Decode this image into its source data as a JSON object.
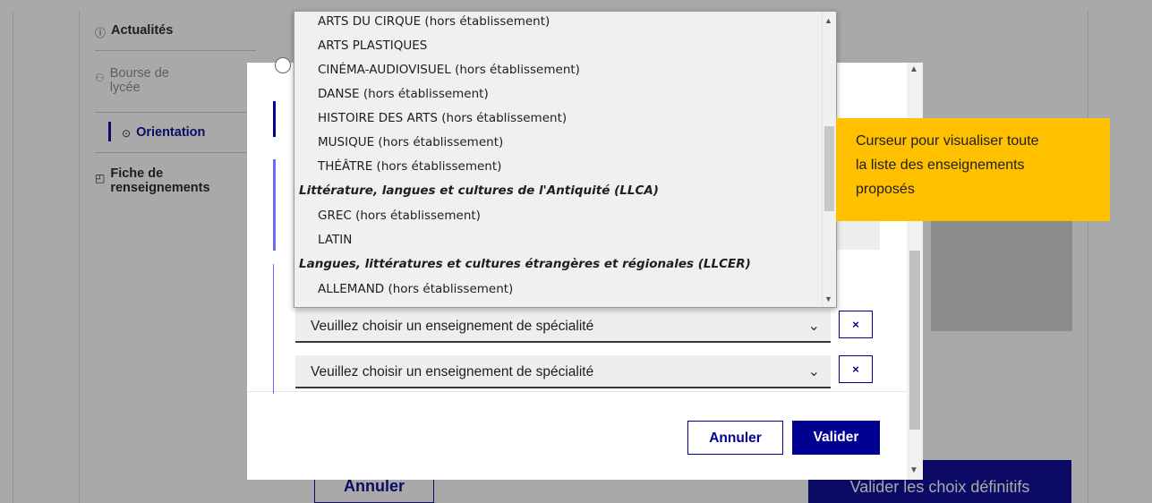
{
  "sidebar": {
    "items": [
      {
        "icon": "info-circle-icon",
        "glyph": "ⓘ",
        "label": "Actualités"
      },
      {
        "icon": "people-icon",
        "glyph": "⚇",
        "label_line1": "Bourse de",
        "label_line2": "lycée"
      },
      {
        "icon": "compass-icon",
        "glyph": "⊙",
        "label": "Orientation"
      },
      {
        "icon": "document-icon",
        "glyph": "◰",
        "label_line1": "Fiche de",
        "label_line2": "renseignements"
      }
    ]
  },
  "page": {
    "cancel_label": "Annuler",
    "validate_final_label": "Valider les choix définitifs"
  },
  "modal": {
    "selects": [
      {
        "value": "Veuillez choisir un enseignement de spécialité"
      },
      {
        "value": "Veuillez choisir un enseignement de spécialité"
      }
    ],
    "remove_label": "×",
    "cancel_label": "Annuler",
    "validate_label": "Valider"
  },
  "dropdown": {
    "options": [
      {
        "type": "opt",
        "label": "ARTS DU CIRQUE (hors établissement)"
      },
      {
        "type": "opt",
        "label": "ARTS PLASTIQUES"
      },
      {
        "type": "opt",
        "label": "CINÉMA-AUDIOVISUEL (hors établissement)"
      },
      {
        "type": "opt",
        "label": "DANSE (hors établissement)"
      },
      {
        "type": "opt",
        "label": "HISTOIRE DES ARTS (hors établissement)"
      },
      {
        "type": "opt",
        "label": "MUSIQUE (hors établissement)"
      },
      {
        "type": "opt",
        "label": "THÉÂTRE (hors établissement)"
      },
      {
        "type": "grp",
        "label": "Littérature, langues et cultures de l'Antiquité (LLCA)"
      },
      {
        "type": "opt",
        "label": "GREC (hors établissement)"
      },
      {
        "type": "opt",
        "label": "LATIN"
      },
      {
        "type": "grp",
        "label": "Langues, littératures et cultures étrangères et régionales (LLCER)"
      },
      {
        "type": "opt",
        "label": "ALLEMAND (hors établissement)"
      }
    ]
  },
  "callout": {
    "line1": "Curseur pour visualiser toute",
    "line2": "la liste des enseignements",
    "line3": "proposés",
    "color": "#ffc000"
  },
  "colors": {
    "accent": "#000091",
    "overlay": "rgba(30,30,30,0.38)"
  }
}
